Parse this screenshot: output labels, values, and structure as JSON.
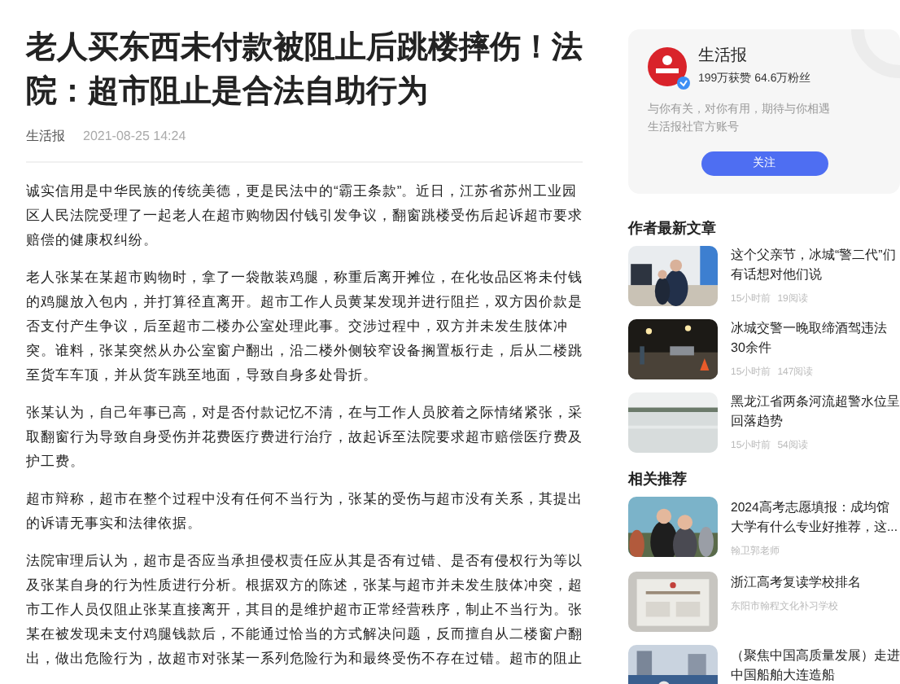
{
  "article": {
    "title": "老人买东西未付款被阻止后跳楼摔伤！法院：超市阻止是合法自助行为",
    "source": "生活报",
    "date": "2021-08-25 14:24",
    "paragraphs": [
      "诚实信用是中华民族的传统美德，更是民法中的“霸王条款”。近日，江苏省苏州工业园区人民法院受理了一起老人在超市购物因付钱引发争议，翻窗跳楼受伤后起诉超市要求赔偿的健康权纠纷。",
      "老人张某在某超市购物时，拿了一袋散装鸡腿，称重后离开摊位，在化妆品区将未付钱的鸡腿放入包内，并打算径直离开。超市工作人员黄某发现并进行阻拦，双方因价款是否支付产生争议，后至超市二楼办公室处理此事。交涉过程中，双方并未发生肢体冲突。谁料，张某突然从办公室窗户翻出，沿二楼外侧较窄设备搁置板行走，后从二楼跳至货车车顶，并从货车跳至地面，导致自身多处骨折。",
      "张某认为，自己年事已高，对是否付款记忆不清，在与工作人员胶着之际情绪紧张，采取翻窗行为导致自身受伤并花费医疗费进行治疗，故起诉至法院要求超市赔偿医疗费及护工费。",
      "超市辩称，超市在整个过程中没有任何不当行为，张某的受伤与超市没有关系，其提出的诉请无事实和法律依据。",
      "法院审理后认为，超市是否应当承担侵权责任应从其是否有过错、是否有侵权行为等以及张某自身的行为性质进行分析。根据双方的陈述，张某与超市并未发生肢体冲突，超市工作人员仅阻止张某直接离开，其目的是维护超市正常经营秩序，制止不当行为。张某在被发现未支付鸡腿钱款后，不能通过恰当的方式解决问题，反而擅自从二楼窗户翻出，做出危险行为，故超市对张某一系列危险行为和最终受伤不存在过错。超市的阻止"
    ]
  },
  "author": {
    "name": "生活报",
    "stats": "199万获赞 64.6万粉丝",
    "bio": [
      "与你有关，对你有用，期待与你相遇",
      "生活报社官方账号"
    ],
    "follow": "关注"
  },
  "latest": {
    "heading": "作者最新文章",
    "items": [
      {
        "title": "这个父亲节，冰城“警二代”们有话想对他们说",
        "time": "15小时前",
        "reads": "19阅读"
      },
      {
        "title": "冰城交警一晚取缔酒驾违法30余件",
        "time": "15小时前",
        "reads": "147阅读"
      },
      {
        "title": "黑龙江省两条河流超警水位呈回落趋势",
        "time": "15小时前",
        "reads": "54阅读"
      }
    ]
  },
  "related": {
    "heading": "相关推荐",
    "items": [
      {
        "title": "2024高考志愿填报：成均馆大学有什么专业好推荐，这...",
        "source": "翰卫郭老师"
      },
      {
        "title": "浙江高考复读学校排名",
        "source": "东阳市翰程文化补习学校"
      },
      {
        "title": "（聚焦中国高质量发展）走进中国船舶大连造船"
      }
    ]
  }
}
